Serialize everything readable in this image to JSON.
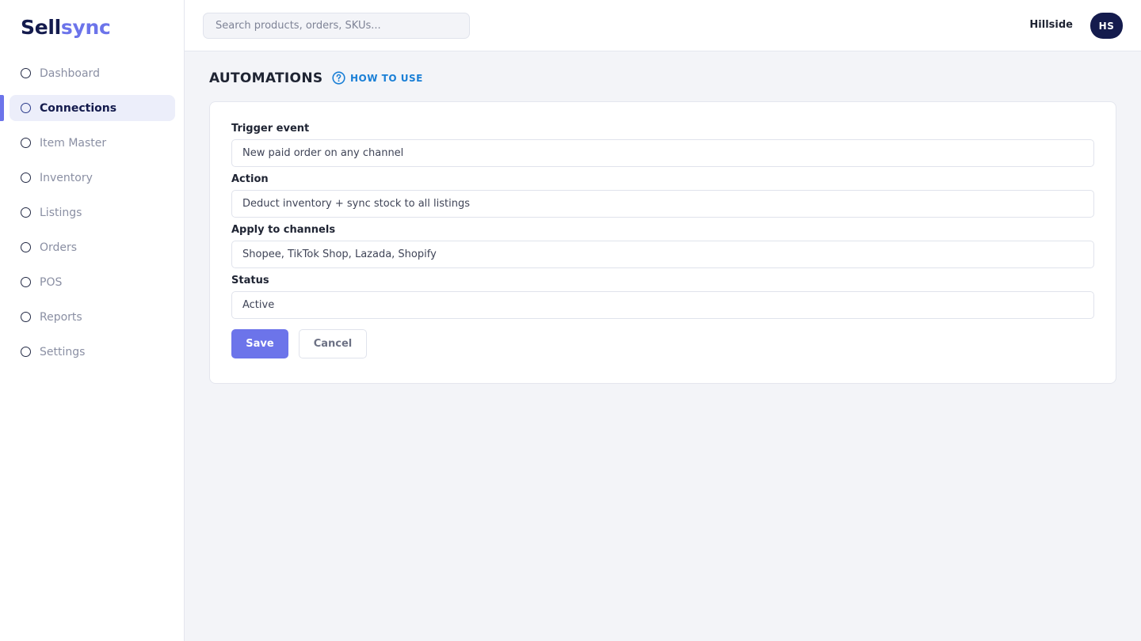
{
  "brand": {
    "part1": "Sell",
    "part2": "sync"
  },
  "sidebar": {
    "items": [
      {
        "label": "Dashboard",
        "icon": "circle-icon"
      },
      {
        "label": "Connections",
        "icon": "circle-icon",
        "active": true
      },
      {
        "label": "Item Master",
        "icon": "circle-icon"
      },
      {
        "label": "Inventory",
        "icon": "circle-icon"
      },
      {
        "label": "Listings",
        "icon": "circle-icon"
      },
      {
        "label": "Orders",
        "icon": "circle-icon"
      },
      {
        "label": "POS",
        "icon": "circle-icon"
      },
      {
        "label": "Reports",
        "icon": "circle-icon"
      },
      {
        "label": "Settings",
        "icon": "circle-icon"
      }
    ]
  },
  "header": {
    "search_placeholder": "Search products, orders, SKUs...",
    "org_name": "Hillside",
    "avatar_initials": "HS"
  },
  "main": {
    "title": "AUTOMATIONS",
    "help_link": "HOW TO USE",
    "form": {
      "fields": [
        {
          "label": "Trigger event",
          "value": "New paid order on any channel"
        },
        {
          "label": "Action",
          "value": "Deduct inventory + sync stock to all listings"
        },
        {
          "label": "Apply to channels",
          "value": "Shopee, TikTok Shop, Lazada, Shopify"
        },
        {
          "label": "Status",
          "value": "Active"
        }
      ],
      "save_label": "Save",
      "cancel_label": "Cancel"
    }
  },
  "colors": {
    "accent": "#6c74ea",
    "brand_dark": "#141b4d",
    "link": "#1a7fd6",
    "background": "#f3f4f8"
  }
}
